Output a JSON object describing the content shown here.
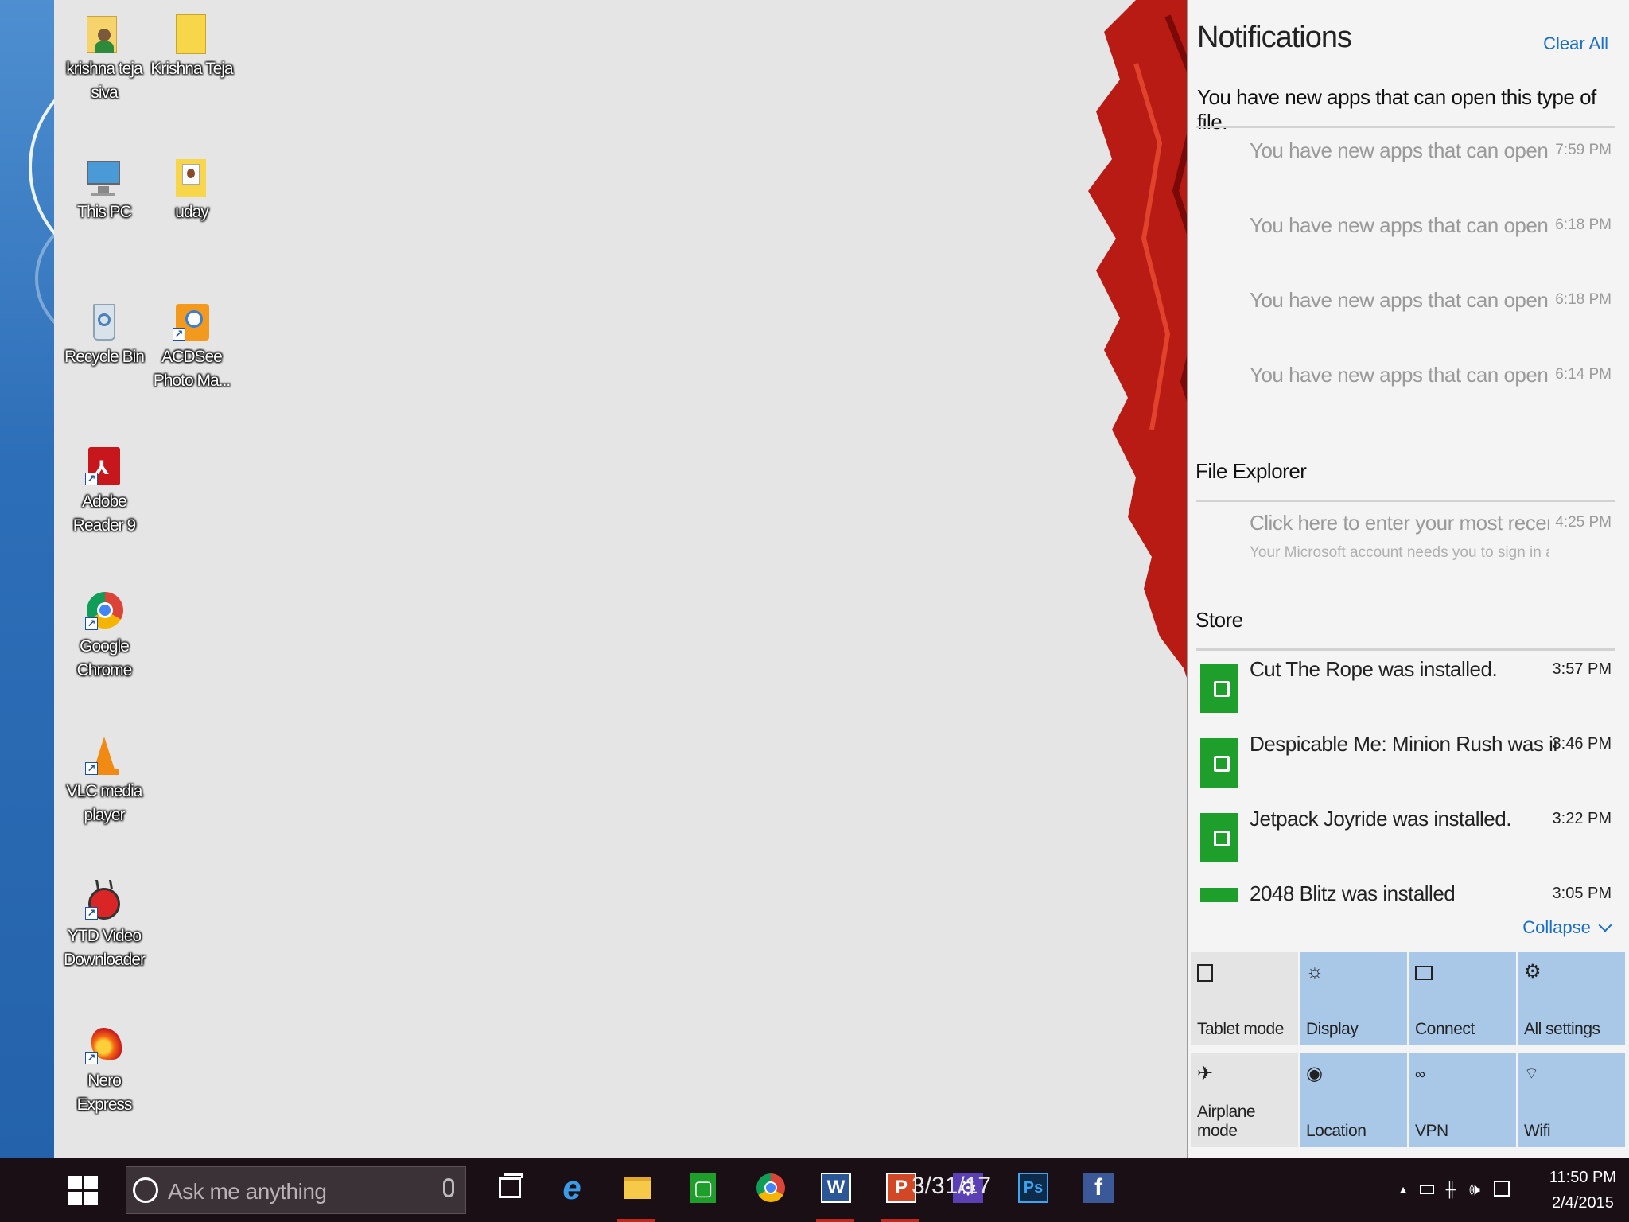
{
  "desktop": {
    "icons": [
      {
        "label": "krishna teja siva",
        "icon": "user-folder-icon"
      },
      {
        "label": "Krishna Teja",
        "icon": "folder-icon"
      },
      {
        "label": "This PC",
        "icon": "computer-icon"
      },
      {
        "label": "uday",
        "icon": "image-folder-icon"
      },
      {
        "label": "Recycle Bin",
        "icon": "recycle-bin-icon"
      },
      {
        "label": "ACDSee Photo Ma...",
        "icon": "acdsee-icon"
      },
      {
        "label": "Adobe Reader 9",
        "icon": "adobe-reader-icon"
      },
      {
        "label": "Google Chrome",
        "icon": "chrome-icon"
      },
      {
        "label": "VLC media player",
        "icon": "vlc-icon"
      },
      {
        "label": "YTD Video Downloader",
        "icon": "ytd-icon"
      },
      {
        "label": "Nero Express",
        "icon": "nero-icon"
      }
    ]
  },
  "action_center": {
    "title": "Notifications",
    "clear_all": "Clear All",
    "groups": {
      "file_assoc": {
        "header": "You have new apps that can open this type of file.",
        "items": [
          {
            "text": "You have new apps that can open this t",
            "time": "7:59 PM"
          },
          {
            "text": "You have new apps that can open this t",
            "time": "6:18 PM"
          },
          {
            "text": "You have new apps that can open this t",
            "time": "6:18 PM"
          },
          {
            "text": "You have new apps that can open this t",
            "time": "6:14 PM"
          }
        ]
      },
      "file_explorer": {
        "header": "File Explorer",
        "item": {
          "text": "Click here to enter your most recent cre",
          "sub": "Your Microsoft account needs you to sign in agai",
          "time": "4:25 PM"
        }
      },
      "store": {
        "header": "Store",
        "items": [
          {
            "text": "Cut The Rope was installed.",
            "time": "3:57 PM"
          },
          {
            "text": "Despicable Me: Minion Rush was installed.",
            "time": "3:46 PM"
          },
          {
            "text": "Jetpack Joyride was installed.",
            "time": "3:22 PM"
          },
          {
            "text": "2048 Blitz was installed",
            "time": "3:05 PM"
          }
        ]
      }
    },
    "collapse": "Collapse",
    "quick_actions": [
      {
        "label": "Tablet mode",
        "icon": "tablet-icon",
        "on": false
      },
      {
        "label": "Display",
        "icon": "brightness-icon",
        "on": true
      },
      {
        "label": "Connect",
        "icon": "connect-icon",
        "on": true
      },
      {
        "label": "All settings",
        "icon": "gear-icon",
        "on": true
      },
      {
        "label": "Airplane mode",
        "icon": "airplane-icon",
        "on": false
      },
      {
        "label": "Location",
        "icon": "location-icon",
        "on": true
      },
      {
        "label": "VPN",
        "icon": "vpn-icon",
        "on": true
      },
      {
        "label": "Wifi",
        "icon": "wifi-icon",
        "on": true
      }
    ]
  },
  "taskbar": {
    "search_placeholder": "Ask me anything",
    "overlay_text": "3/31/17",
    "apps": [
      "task-view",
      "internet-explorer",
      "file-explorer",
      "store",
      "chrome",
      "word",
      "powerpoint",
      "settings",
      "photoshop",
      "facebook"
    ],
    "clock": {
      "time": "11:50 PM",
      "date": "2/4/2015"
    }
  },
  "colors": {
    "accent": "#1a6ec7",
    "quick_action_on": "#a9c8e8",
    "store_green": "#1e9e2a",
    "taskbar": "#1a0f14"
  }
}
